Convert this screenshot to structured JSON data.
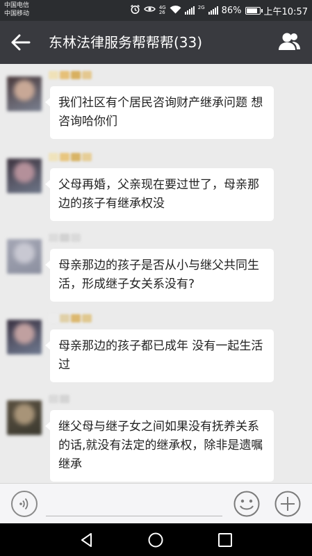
{
  "status_bar": {
    "carrier_1": "中国电信",
    "carrier_2": "中国移动",
    "net_top": "4G",
    "net_bottom": "26",
    "net2_top": "2G",
    "battery": "86%",
    "battery_level": 0.86,
    "time": "上午10:57"
  },
  "header": {
    "title": "东林法律服务帮帮帮(33)",
    "back_icon": "arrow-left-icon",
    "members_icon": "people-icon"
  },
  "messages": [
    {
      "text": "我们社区有个居民咨询财产继承问题 想咨询哈你们",
      "avatar_colors": [
        "#4a3a3c",
        "#c8a896",
        "#7a8090"
      ],
      "nick_colors": [
        "#efe1b8",
        "#e6c078",
        "#d8b060",
        "#e4c890"
      ]
    },
    {
      "text": "父母再婚，父亲现在要过世了，母亲那边的孩子有继承权没",
      "avatar_colors": [
        "#3e3440",
        "#b4909a",
        "#6e7688"
      ],
      "nick_colors": [
        "#efe3bc",
        "#e8c680",
        "#d8b466",
        "#e6ce98"
      ]
    },
    {
      "text": "母亲那边的孩子是否从小与继父共同生活，形成继子女关系没有?",
      "avatar_colors": [
        "#a4a6b4",
        "#c8c8d2",
        "#8c90a0"
      ],
      "nick_colors": [
        "#dcdcdc",
        "#d2d2d2",
        "#dadada"
      ]
    },
    {
      "text": "母亲那边的孩子都已成年 没有一起生活过",
      "avatar_colors": [
        "#3a3242",
        "#c0a0a0",
        "#707a90"
      ],
      "nick_colors": [
        "#ececec",
        "#e0d0a8",
        "#dcb870",
        "#e0c890"
      ]
    },
    {
      "text": "继父母与继子女之间如果没有抚养关系的话,就没有法定的继承权，除非是遗嘱继承",
      "avatar_colors": [
        "#5a5040",
        "#a89478",
        "#3c3a30"
      ],
      "nick_colors": [
        "#dadada",
        "#d4d4d4"
      ]
    }
  ],
  "input_bar": {
    "voice_icon": "voice-icon",
    "emoji_icon": "emoji-icon",
    "plus_icon": "plus-icon"
  },
  "nav_bar": {
    "back_icon": "triangle-back-icon",
    "home_icon": "circle-home-icon",
    "recent_icon": "square-recent-icon"
  }
}
